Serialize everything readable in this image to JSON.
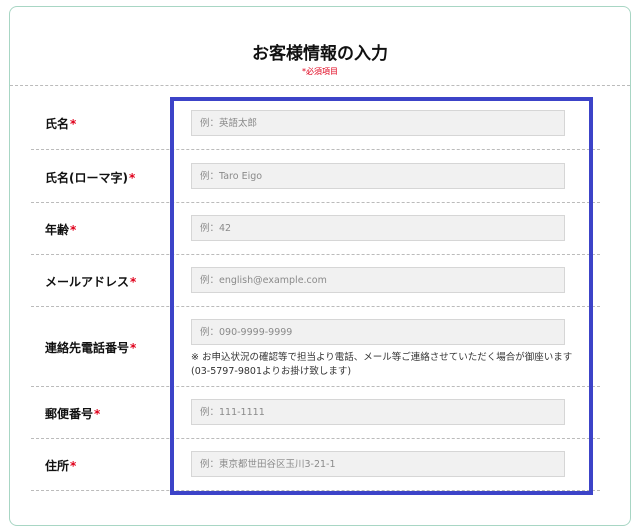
{
  "form": {
    "title": "お客様情報の入力",
    "required_note": "*必須項目",
    "required_mark": "*",
    "fields": [
      {
        "label": "氏名",
        "placeholder": "例：英語太郎"
      },
      {
        "label": "氏名(ローマ字)",
        "placeholder": "例：Taro Eigo"
      },
      {
        "label": "年齢",
        "placeholder": "例：42"
      },
      {
        "label": "メールアドレス",
        "placeholder": "例：english@example.com"
      },
      {
        "label": "連絡先電話番号",
        "placeholder": "例：090-9999-9999",
        "note": "※ お申込状況の確認等で担当より電話、メール等ご連絡させていただく場合が御座います(03-5797-9801よりお掛け致します)"
      },
      {
        "label": "郵便番号",
        "placeholder": "例：111-1111"
      },
      {
        "label": "住所",
        "placeholder": "例：東京都世田谷区玉川3-21-1"
      }
    ]
  },
  "colors": {
    "required": "#e0001b",
    "highlight": "#3c43c8",
    "card_border": "#a8d6c4"
  }
}
